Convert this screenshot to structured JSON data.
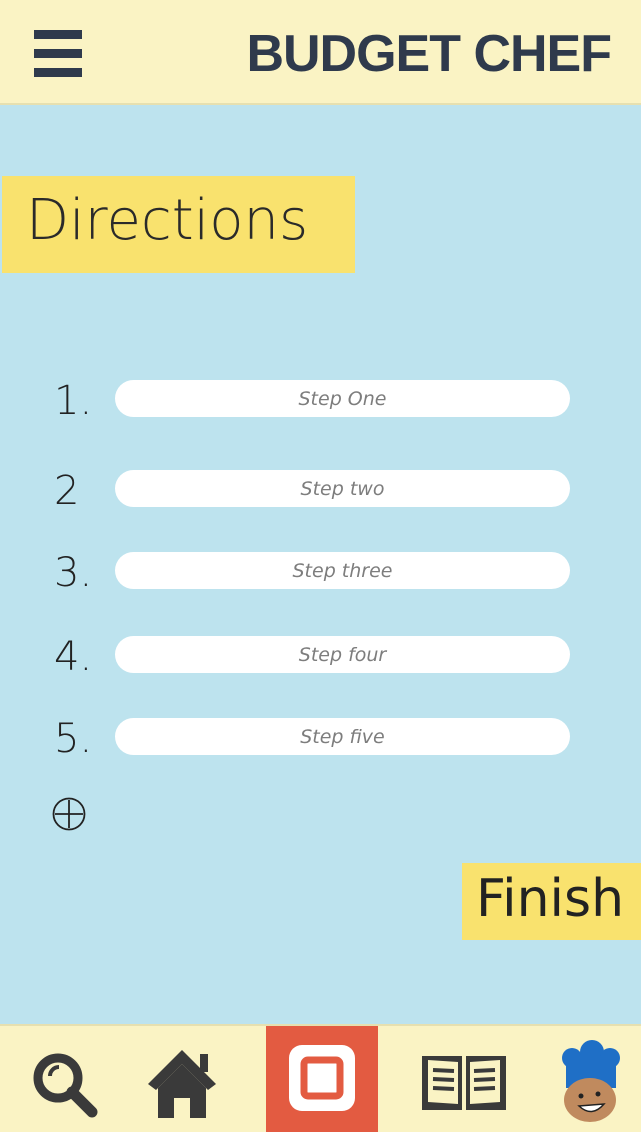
{
  "header": {
    "title": "BUDGET CHEF",
    "menu_icon": "hamburger-menu-icon"
  },
  "section": {
    "title": "Directions"
  },
  "steps": [
    {
      "number": "1.",
      "placeholder": "Step One"
    },
    {
      "number": "2",
      "placeholder": "Step two"
    },
    {
      "number": "3.",
      "placeholder": "Step three"
    },
    {
      "number": "4.",
      "placeholder": "Step four"
    },
    {
      "number": "5.",
      "placeholder": "Step five"
    }
  ],
  "add_step_icon": "circle-plus-icon",
  "finish": {
    "label": "Finish"
  },
  "tabbar": {
    "items": [
      {
        "icon": "search-icon",
        "active": false
      },
      {
        "icon": "home-icon",
        "active": false
      },
      {
        "icon": "stop-square-icon",
        "active": true
      },
      {
        "icon": "open-book-icon",
        "active": false
      },
      {
        "icon": "chef-avatar-icon",
        "active": false
      }
    ]
  },
  "colors": {
    "background": "#bde3ee",
    "header_bg": "#faf3c4",
    "accent_yellow": "#f9e26e",
    "active_tab": "#e35b41",
    "dark_text": "#2f3a4c"
  }
}
